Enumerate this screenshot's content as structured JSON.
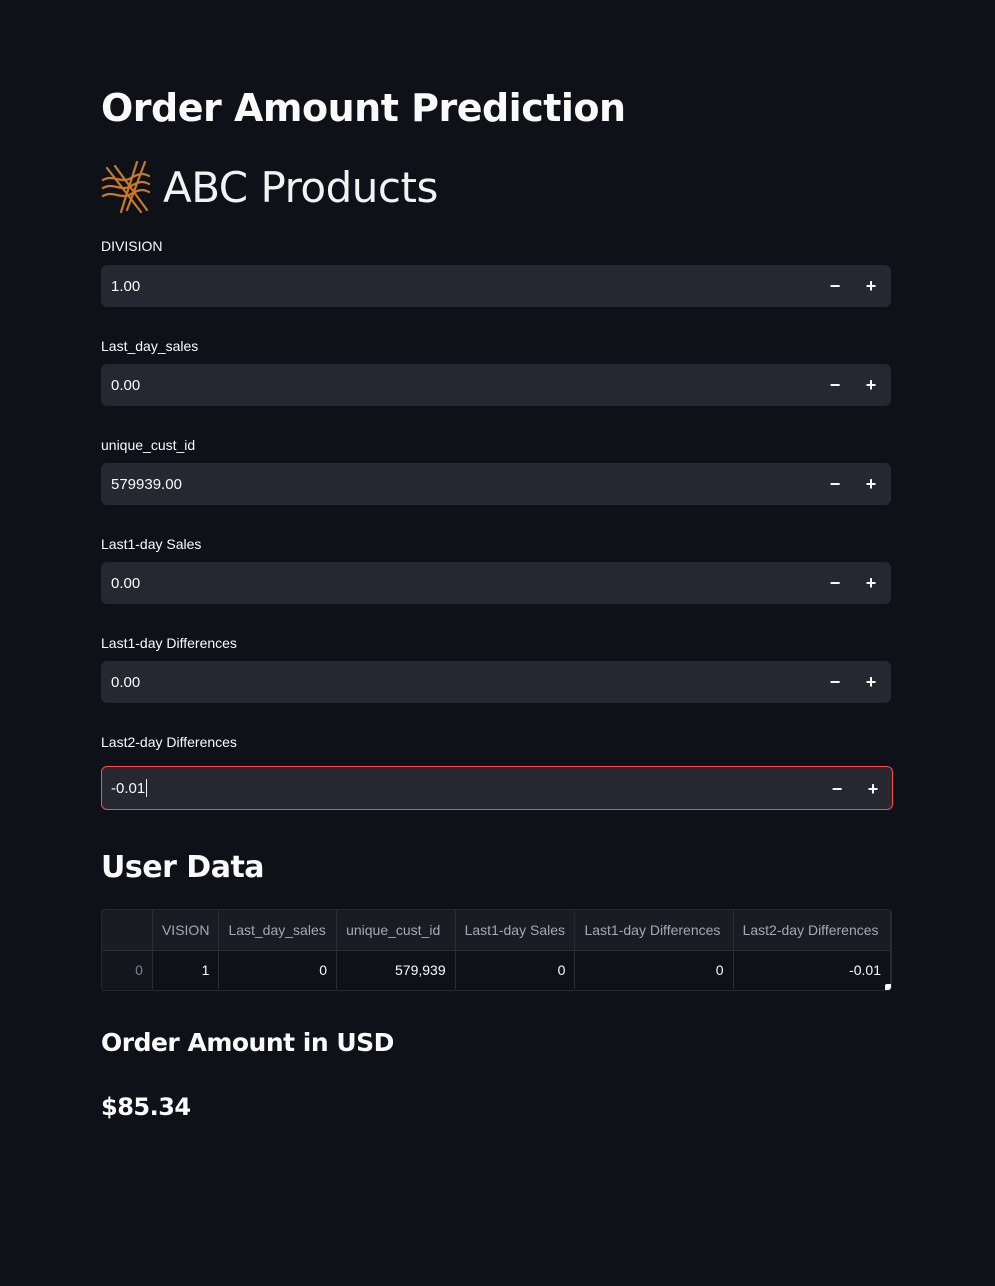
{
  "page": {
    "title": "Order Amount Prediction",
    "logo_text": "ABC Products"
  },
  "fields": [
    {
      "label": "DIVISION",
      "value": "1.00"
    },
    {
      "label": "Last_day_sales",
      "value": "0.00"
    },
    {
      "label": "unique_cust_id",
      "value": "579939.00"
    },
    {
      "label": "Last1-day Sales",
      "value": "0.00"
    },
    {
      "label": "Last1-day Differences",
      "value": "0.00"
    },
    {
      "label": "Last2-day Differences",
      "value": "-0.01",
      "focused": true
    }
  ],
  "stepper": {
    "minus": "−",
    "plus": "+"
  },
  "user_data": {
    "title": "User Data",
    "columns": [
      "",
      "VISION",
      "Last_day_sales",
      "unique_cust_id",
      "Last1-day Sales",
      "Last1-day Differences",
      "Last2-day Differences"
    ],
    "rows": [
      [
        "0",
        "1",
        "0",
        "579,939",
        "0",
        "0",
        "-0.01"
      ]
    ]
  },
  "result": {
    "title": "Order Amount in USD",
    "amount": "$85.34"
  },
  "colors": {
    "background": "#0e1117",
    "input_bg": "#262730",
    "focus_border": "#ff4b4b",
    "logo_accent": "#c8782a"
  }
}
